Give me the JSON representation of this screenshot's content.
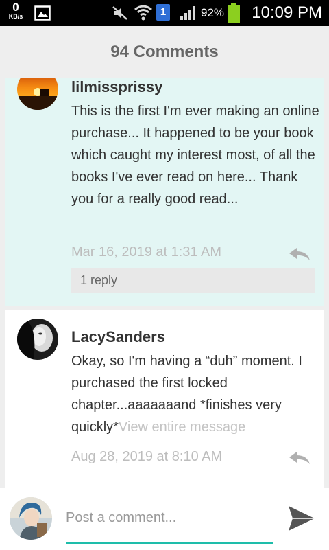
{
  "status_bar": {
    "data_speed": "0",
    "data_unit": "KB/s",
    "sim_slot": "1",
    "battery_percent": "92%",
    "time": "10:09 PM",
    "icons": [
      "gallery-icon",
      "mute-icon",
      "wifi-icon",
      "signal-icon",
      "battery-icon"
    ]
  },
  "header": {
    "title": "94 Comments"
  },
  "comments": [
    {
      "username": "lilmissprissy",
      "text": "This is the first I'm ever making an online purchase...  It  happened to be your book which caught my interest most,  of all the books I've ever read on here... Thank you for a really good read...",
      "timestamp": "Mar 16, 2019 at 1:31 AM",
      "replies_label": "1 reply",
      "highlighted": true
    },
    {
      "username": "LacySanders",
      "text": "Okay, so I'm having a “duh” moment. I purchased the first locked chapter...aaaaaaand *finishes very quickly*",
      "more_label": "View entire message",
      "timestamp": "Aug 28, 2019 at 8:10 AM"
    }
  ],
  "composer": {
    "placeholder": "Post a comment..."
  },
  "colors": {
    "accent": "#1ebdaa",
    "highlight_bg": "#e3f6f4",
    "status_bar_bg": "#000000",
    "battery": "#8ccf1f"
  }
}
